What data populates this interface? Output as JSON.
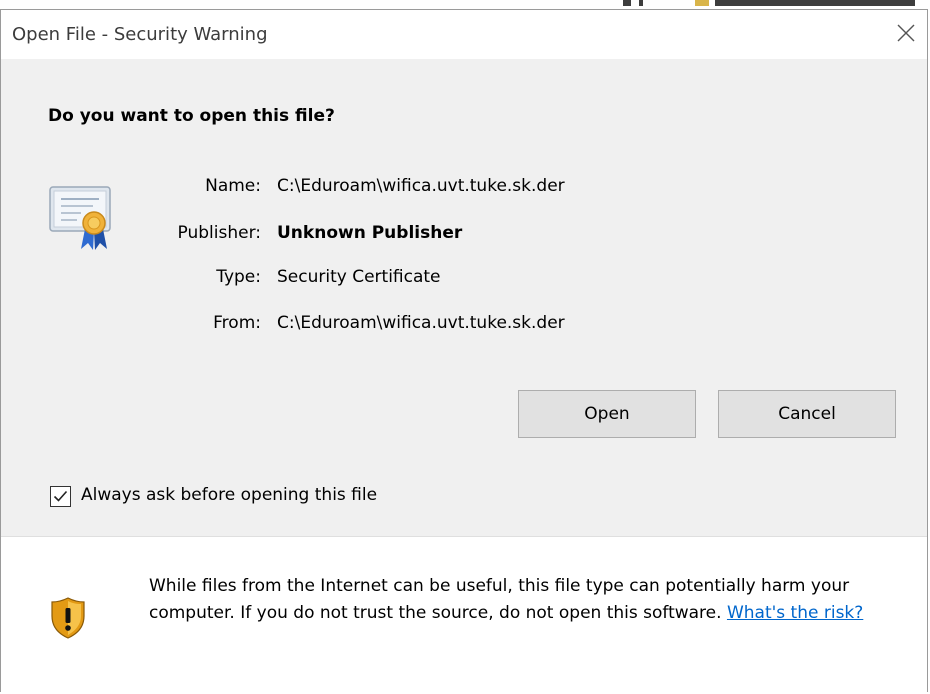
{
  "window": {
    "title": "Open File - Security Warning"
  },
  "dialog": {
    "heading": "Do you want to open this file?",
    "fields": [
      {
        "label": "Name:",
        "value": "C:\\Eduroam\\wifica.uvt.tuke.sk.der",
        "bold": false
      },
      {
        "label": "Publisher:",
        "value": "Unknown Publisher",
        "bold": true
      },
      {
        "label": "Type:",
        "value": "Security Certificate",
        "bold": false
      },
      {
        "label": "From:",
        "value": "C:\\Eduroam\\wifica.uvt.tuke.sk.der",
        "bold": false
      }
    ],
    "buttons": {
      "open_label": "Open",
      "cancel_label": "Cancel"
    },
    "checkbox": {
      "label": "Always ask before opening this file",
      "checked": true
    },
    "warning": {
      "text": "While files from the Internet can be useful, this file type can potentially harm your computer. If you do not trust the source, do not open this software.",
      "link_text": "What's the risk?"
    }
  },
  "icons": {
    "close": "close-icon",
    "certificate": "certificate-icon",
    "shield": "warning-shield-icon",
    "checkmark": "checkmark-icon"
  },
  "colors": {
    "dialog_bg": "#f0f0f0",
    "button_bg": "#e1e1e1",
    "link": "#0066cc"
  }
}
